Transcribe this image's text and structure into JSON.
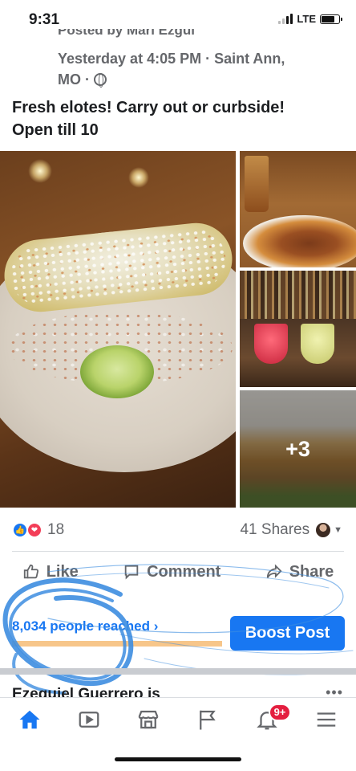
{
  "status": {
    "time": "9:31",
    "network": "LTE"
  },
  "post": {
    "header_partial": "Posted by Mari Ezgui",
    "meta_line1": "Yesterday at 4:05 PM · Saint Ann,",
    "meta_line2": "MO ·",
    "text_line1": "Fresh elotes! Carry out or curbside!",
    "text_line2": "Open till 10",
    "more_photos": "+3",
    "reaction_count": "18",
    "shares": "41 Shares"
  },
  "actions": {
    "like": "Like",
    "comment": "Comment",
    "share": "Share"
  },
  "insights": {
    "reached": "8,034 people reached ›",
    "reach_fraction": 1.0,
    "boost_label": "Boost Post"
  },
  "next_post": {
    "author_partial": "Ezequiel Guerrero is"
  },
  "tabbar": {
    "notifications_badge": "9+"
  },
  "colors": {
    "brand": "#1877f2",
    "badge": "#e41e3f",
    "reach_bar": "#f7c68a"
  },
  "icons": [
    "globe-icon",
    "like-reaction-icon",
    "love-reaction-icon",
    "like-icon",
    "comment-icon",
    "share-icon",
    "home-icon",
    "watch-icon",
    "marketplace-icon",
    "pages-flag-icon",
    "bell-icon",
    "menu-icon"
  ]
}
